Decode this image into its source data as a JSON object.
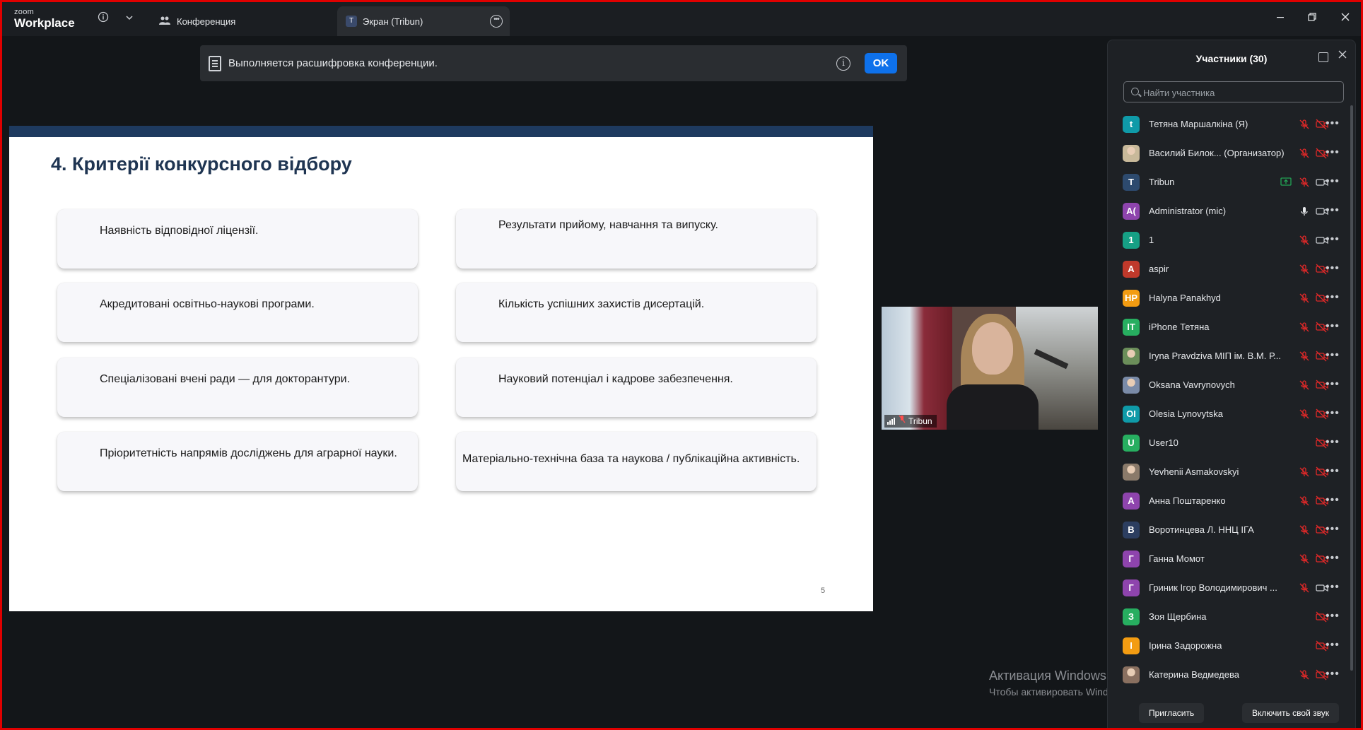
{
  "app": {
    "logo_top": "zoom",
    "logo_bottom": "Workplace"
  },
  "tabs": [
    {
      "label": "Конференция"
    },
    {
      "label": "Экран (Tribun)",
      "badge": "T"
    }
  ],
  "banner": {
    "text": "Выполняется расшифровка конференции.",
    "ok_label": "OK"
  },
  "slide": {
    "title": "4. Критерії конкурсного відбору",
    "page_number": "5",
    "cards": [
      "Наявність відповідної ліцензії.",
      "Результати прийому, навчання та випуску.",
      "Акредитовані освітньо-наукові програми.",
      "Кількість успішних захистів дисертацій.",
      "Спеціалізовані вчені ради — для докторантури.",
      "Науковий потенціал і кадрове забезпечення.",
      "Пріоритетність напрямів досліджень для аграрної науки.",
      "Матеріально-технічна база та наукова / публікаційна активність."
    ]
  },
  "video": {
    "name": "Tribun"
  },
  "watermark": {
    "line1": "Активация Windows",
    "line2": "Чтобы активировать Windows, перейдите в раздел \"Параметры\"."
  },
  "participants": {
    "title": "Участники (30)",
    "search_placeholder": "Найти участника",
    "invite_label": "Пригласить",
    "unmute_label": "Включить свой звук",
    "list": [
      {
        "initials": "t",
        "color": "#0f9aa8",
        "name": "Тетяна Маршалкіна (Я)",
        "mic": "off",
        "cam": "off"
      },
      {
        "initials": "",
        "color": "#c8b99a",
        "name": "Василий Билок... (Организатор)",
        "mic": "off",
        "cam": "off",
        "photo": true
      },
      {
        "initials": "T",
        "color": "#2d4a6e",
        "name": "Tribun",
        "mic": "off",
        "cam": "on",
        "share": true
      },
      {
        "initials": "A(",
        "color": "#8e44ad",
        "name": "Administrator (mic)",
        "mic": "on",
        "cam": "on"
      },
      {
        "initials": "1",
        "color": "#16a085",
        "name": "1",
        "mic": "off",
        "cam": "on"
      },
      {
        "initials": "A",
        "color": "#c0392b",
        "name": "aspir",
        "mic": "off",
        "cam": "off"
      },
      {
        "initials": "HP",
        "color": "#f39c12",
        "name": "Halyna Panakhyd",
        "mic": "off",
        "cam": "off"
      },
      {
        "initials": "IT",
        "color": "#27ae60",
        "name": "iPhone Тетяна",
        "mic": "off",
        "cam": "off"
      },
      {
        "initials": "",
        "color": "#6b8e5a",
        "name": "Iryna Pravdziva МІП ім. В.М. Р...",
        "mic": "off",
        "cam": "off",
        "photo": true
      },
      {
        "initials": "",
        "color": "#7a8ba8",
        "name": "Oksana Vavrynovych",
        "mic": "off",
        "cam": "off",
        "photo": true
      },
      {
        "initials": "OI",
        "color": "#0f9aa8",
        "name": "Olesia Lynovytska",
        "mic": "off",
        "cam": "off"
      },
      {
        "initials": "U",
        "color": "#27ae60",
        "name": "User10",
        "mic": "",
        "cam": "off"
      },
      {
        "initials": "",
        "color": "#8a7a6a",
        "name": "Yevhenii Asmakovskyi",
        "mic": "off",
        "cam": "off",
        "photo": true
      },
      {
        "initials": "A",
        "color": "#8e44ad",
        "name": "Анна Поштаренко",
        "mic": "off",
        "cam": "off"
      },
      {
        "initials": "B",
        "color": "#2c3e60",
        "name": "Воротинцева Л. ННЦ ІГА",
        "mic": "off",
        "cam": "off"
      },
      {
        "initials": "Г",
        "color": "#8e44ad",
        "name": "Ганна Момот",
        "mic": "off",
        "cam": "off"
      },
      {
        "initials": "Г",
        "color": "#8e44ad",
        "name": "Гриник Ігор Володимирович ...",
        "mic": "off",
        "cam": "on"
      },
      {
        "initials": "З",
        "color": "#27ae60",
        "name": "Зоя Щербина",
        "mic": "",
        "cam": "off"
      },
      {
        "initials": "І",
        "color": "#f39c12",
        "name": "Ірина Задорожна",
        "mic": "",
        "cam": "off"
      },
      {
        "initials": "",
        "color": "#8a7060",
        "name": "Катерина Ведмедева",
        "mic": "off",
        "cam": "off",
        "photo": true
      }
    ]
  }
}
